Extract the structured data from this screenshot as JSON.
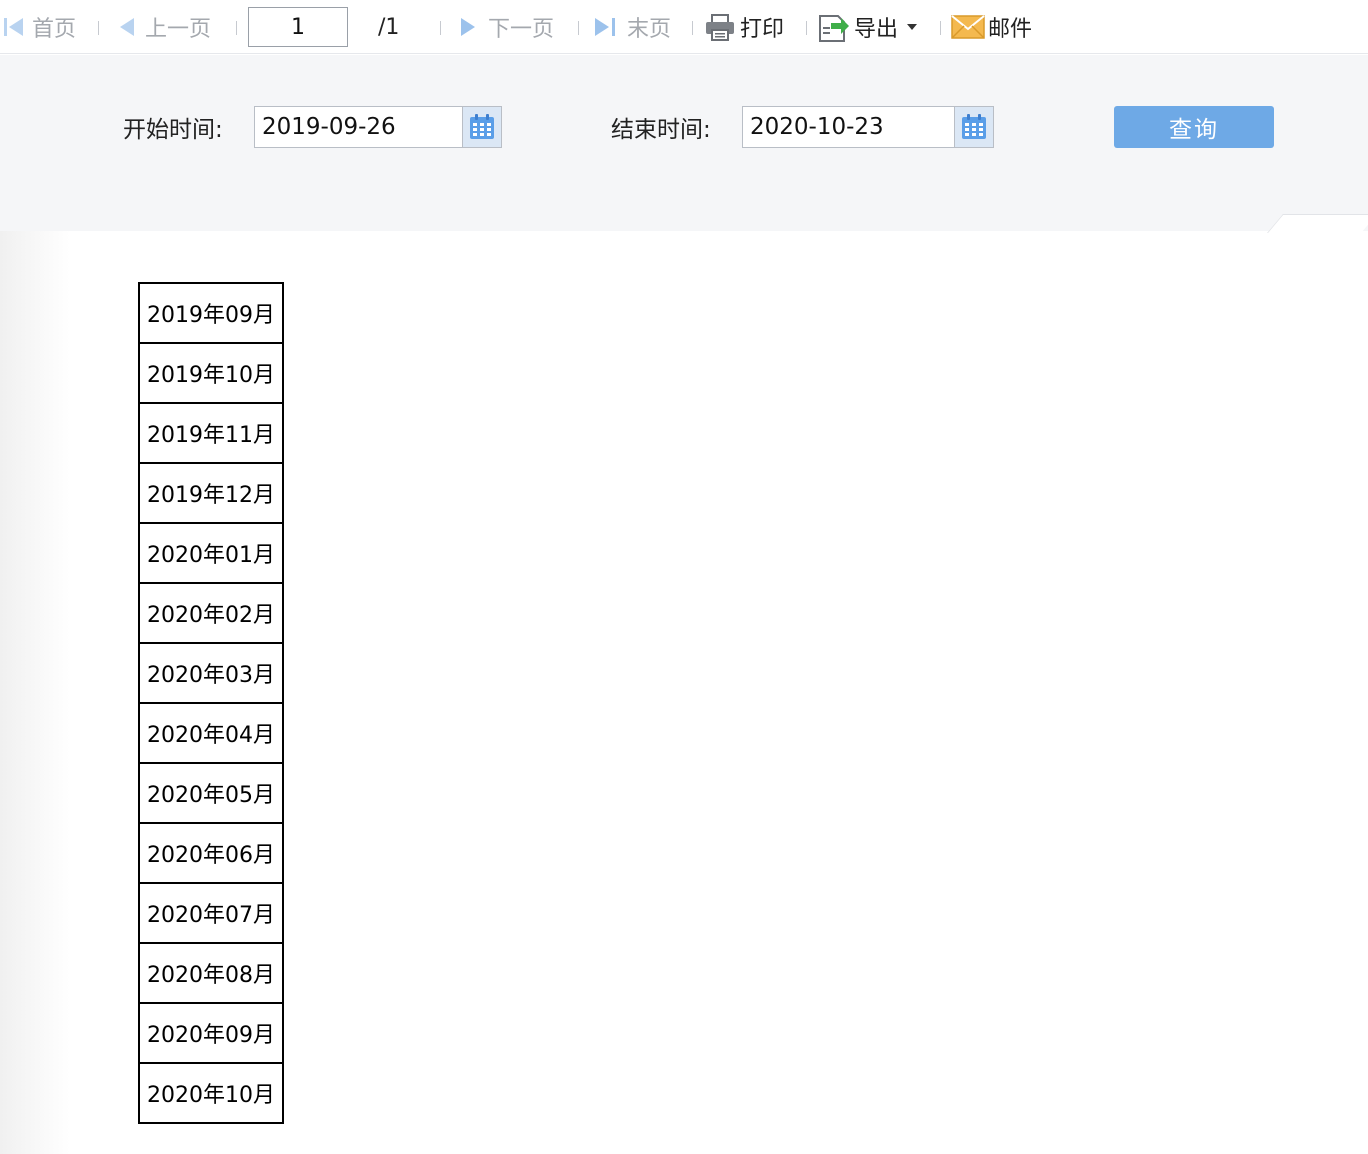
{
  "toolbar": {
    "first_label": "首页",
    "prev_label": "上一页",
    "page_value": "1",
    "page_total": "/1",
    "next_label": "下一页",
    "last_label": "末页",
    "print_label": "打印",
    "export_label": "导出",
    "mail_label": "邮件",
    "icons": [
      "first-page-icon",
      "prev-page-icon",
      "next-page-icon",
      "last-page-icon",
      "printer-icon",
      "export-icon",
      "dropdown-caret-icon",
      "mail-icon"
    ]
  },
  "params": {
    "start_label": "开始时间:",
    "start_value": "2019-09-26",
    "end_label": "结束时间:",
    "end_value": "2020-10-23",
    "query_label": "查询",
    "icons": [
      "calendar-icon"
    ]
  },
  "report": {
    "rows": [
      "2019年09月",
      "2019年10月",
      "2019年11月",
      "2019年12月",
      "2020年01月",
      "2020年02月",
      "2020年03月",
      "2020年04月",
      "2020年05月",
      "2020年06月",
      "2020年07月",
      "2020年08月",
      "2020年09月",
      "2020年10月"
    ]
  },
  "colors": {
    "accent": "#6ea9e6",
    "disabled_text": "#a4a8ae",
    "nav_arrow": "#7fb0e6",
    "panel_bg": "#f5f6f8"
  }
}
